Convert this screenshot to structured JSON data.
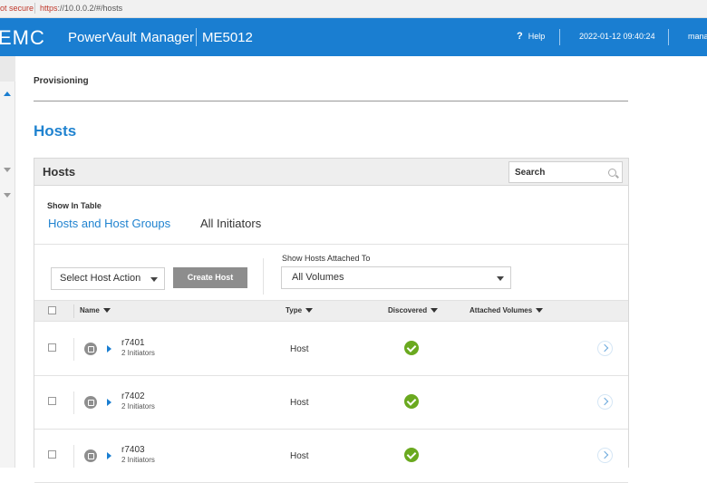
{
  "browser": {
    "security": "ot secure",
    "url_protocol": "https",
    "url_rest": "://10.0.0.2/#/hosts"
  },
  "header": {
    "brand": "EMC",
    "app_name": "PowerVault Manager",
    "model": "ME5012",
    "help_label": "Help",
    "datetime": "2022-01-12 09:40:24",
    "user": "mana"
  },
  "breadcrumb": "Provisioning",
  "page_title": "Hosts",
  "panel": {
    "title": "Hosts",
    "search_placeholder": "Search",
    "show_in_table_label": "Show In Table",
    "tabs": [
      {
        "label": "Hosts and Host Groups",
        "active": true
      },
      {
        "label": "All Initiators",
        "active": false
      }
    ],
    "host_action_placeholder": "Select Host Action",
    "create_host_label": "Create Host",
    "attached_to_label": "Show Hosts Attached To",
    "attached_to_value": "All Volumes"
  },
  "table": {
    "columns": [
      "Name",
      "Type",
      "Discovered",
      "Attached Volumes"
    ],
    "rows": [
      {
        "name": "r7401",
        "initiators": "2 Initiators",
        "type": "Host",
        "discovered": true
      },
      {
        "name": "r7402",
        "initiators": "2 Initiators",
        "type": "Host",
        "discovered": true
      },
      {
        "name": "r7403",
        "initiators": "2 Initiators",
        "type": "Host",
        "discovered": true
      }
    ]
  },
  "colors": {
    "header_blue": "#1a7ed1",
    "title_blue": "#2083d0",
    "success_green": "#6aa91f"
  },
  "icons": {
    "search": "search-icon",
    "host": "host-icon",
    "discovered": "check-circle-icon",
    "details": "chevron-right-circle-icon"
  }
}
